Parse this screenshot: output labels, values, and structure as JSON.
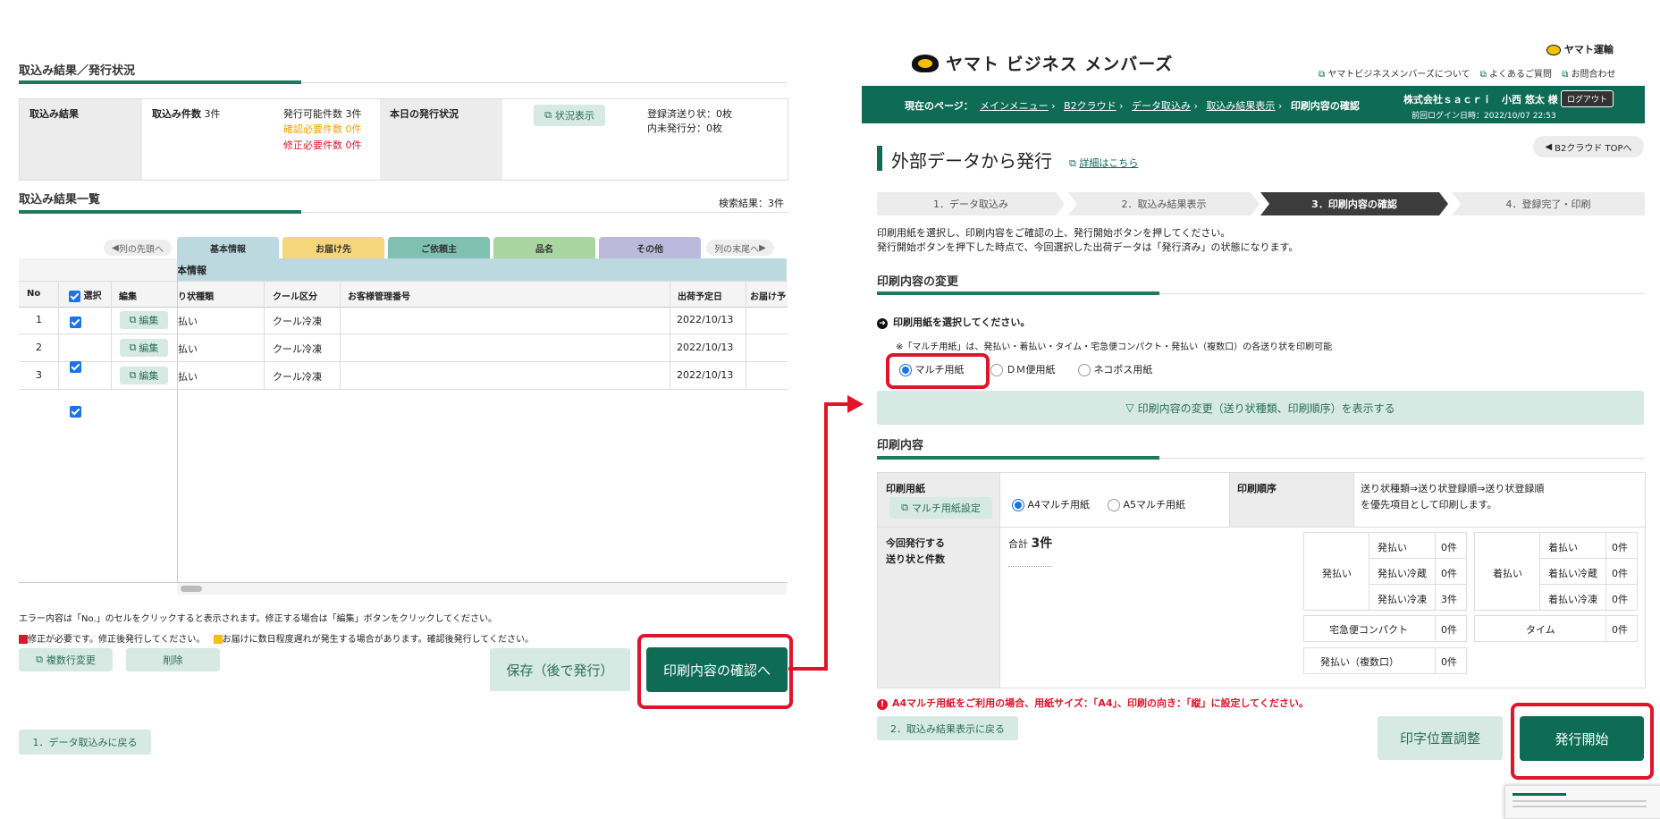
{
  "left": {
    "status_title": "取込み結果／発行状況",
    "import_result_label": "取込み結果",
    "import_count_label": "取込み件数",
    "import_count_value": "3件",
    "issuable_count": "発行可能件数 3件",
    "confirm_needed": "確認必要件数 0件",
    "fix_needed": "修正必要件数 0件",
    "today_status_label": "本日の発行状況",
    "status_view_button": "状況表示",
    "registered": "登録済送り状：0枚",
    "unissued": "内未発行分：0枚",
    "list_title": "取込み結果一覧",
    "search_result": "検索結果：3件",
    "col_first": "列の先頭へ",
    "col_last": "列の末尾へ",
    "tabs": [
      "基本情報",
      "お届け先",
      "ご依頼主",
      "品名",
      "その他"
    ],
    "tab_colors": [
      "#bcd9e0",
      "#f5d67a",
      "#7fc0b2",
      "#a8d5a0",
      "#bdb9dc"
    ],
    "group_header": "本情報",
    "headers": [
      "No",
      "選択",
      "編集",
      "り状種類",
      "クール区分",
      "お客様管理番号",
      "出荷予定日",
      "お届け予"
    ],
    "edit_label": "編集",
    "rows": [
      {
        "no": "1",
        "type": "払い",
        "cool": "クール冷凍",
        "date": "2022/10/13"
      },
      {
        "no": "2",
        "type": "払い",
        "cool": "クール冷凍",
        "date": "2022/10/13"
      },
      {
        "no": "3",
        "type": "払い",
        "cool": "クール冷凍",
        "date": "2022/10/13"
      }
    ],
    "error_note": "エラー内容は「No.」のセルをクリックすると表示されます。修正する場合は「編集」ボタンをクリックしてください。",
    "legend_red": "修正が必要です。修正後発行してください。",
    "legend_yellow": "お届けに数日程度遅れが発生する場合があります。確認後発行してください。",
    "multi_edit_button": "複数行変更",
    "delete_button": "削除",
    "save_button": "保存（後で発行）",
    "confirm_button": "印刷内容の確認へ",
    "back_button": "1．データ取込みに戻る"
  },
  "right": {
    "logo_text": "ヤマト ビジネス メンバーズ",
    "corp_logo": "ヤマト運輸",
    "top_links": [
      "ヤマトビジネスメンバーズについて",
      "よくあるご質問",
      "お問合わせ"
    ],
    "current_page_label": "現在のページ：",
    "breadcrumb": [
      "メインメニュー",
      "B2クラウド",
      "データ取込み",
      "取込み結果表示",
      "印刷内容の確認"
    ],
    "company": "株式会社ｓａｃｒｉ　小西 悠太 様",
    "logout": "ログアウト",
    "last_login": "前回ログイン日時：2022/10/07 22:53",
    "page_title": "外部データから発行",
    "detail_link": "詳細はこちら",
    "top_button": "B2クラウド TOPへ",
    "steps": [
      "1．データ取込み",
      "2．取込み結果表示",
      "3．印刷内容の確認",
      "4．登録完了・印刷"
    ],
    "intro_1": "印刷用紙を選択し、印刷内容をご確認の上、発行開始ボタンを押してください。",
    "intro_2": "発行開始ボタンを押下した時点で、今回選択した出荷データは「発行済み」の状態になります。",
    "change_title": "印刷内容の変更",
    "select_paper": "印刷用紙を選択してください。",
    "multi_note": "※「マルチ用紙」は、発払い・着払い・タイム・宅急便コンパクト・発払い（複数口）の各送り状を印刷可能",
    "paper_options": [
      "マルチ用紙",
      "ＤＭ便用紙",
      "ネコポス用紙"
    ],
    "expand_button": "印刷内容の変更（送り状種類、印刷順序）を表示する",
    "content_title": "印刷内容",
    "paper_label": "印刷用紙",
    "multi_setting": "マルチ用紙設定",
    "a4": "A4マルチ用紙",
    "a5": "A5マルチ用紙",
    "order_label": "印刷順序",
    "order_text_1": "送り状種類⇒送り状登録順⇒送り状登録順",
    "order_text_2": "を優先項目として印刷します。",
    "issue_label_1": "今回発行する",
    "issue_label_2": "送り状と件数",
    "total_label": "合計",
    "total_value": "3件",
    "prepaid": "発払い",
    "prepaid_rows": [
      [
        "発払い",
        "0件"
      ],
      [
        "発払い冷蔵",
        "0件"
      ],
      [
        "発払い冷凍",
        "3件"
      ]
    ],
    "collect": "着払い",
    "collect_rows": [
      [
        "着払い",
        "0件"
      ],
      [
        "着払い冷蔵",
        "0件"
      ],
      [
        "着払い冷凍",
        "0件"
      ]
    ],
    "compact": [
      "宅急便コンパクト",
      "0件"
    ],
    "time": [
      "タイム",
      "0件"
    ],
    "multi_piece": [
      "発払い（複数口）",
      "0件"
    ],
    "warning": "A4マルチ用紙をご利用の場合、用紙サイズ：「A4」、印刷の向き：「縦」に設定してください。",
    "back_button": "2．取込み結果表示に戻る",
    "adjust_button": "印字位置調整",
    "start_button": "発行開始"
  },
  "accent": "#0e6b55",
  "highlight": "#e0152b"
}
